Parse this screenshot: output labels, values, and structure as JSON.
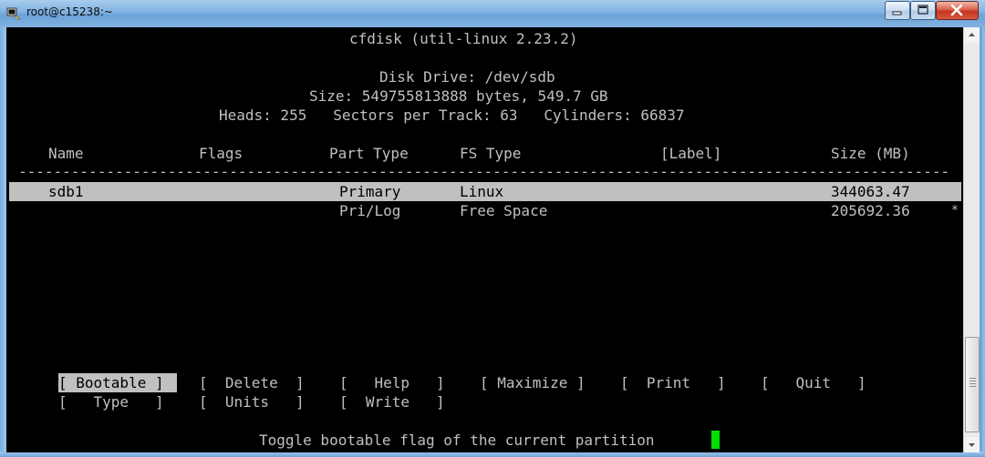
{
  "window": {
    "title": "root@c15238:~",
    "icons": {
      "app": "putty-icon",
      "minimize": "minimize-icon",
      "maximize": "maximize-icon",
      "close": "close-icon"
    }
  },
  "header": {
    "program": "cfdisk (util-linux 2.23.2)",
    "disk_drive": "Disk Drive: /dev/sdb",
    "size": "Size: 549755813888 bytes, 549.7 GB",
    "geometry": "Heads: 255   Sectors per Track: 63   Cylinders: 66837"
  },
  "table": {
    "columns": [
      "Name",
      "Flags",
      "Part Type",
      "FS Type",
      "[Label]",
      "Size (MB)"
    ],
    "separator": "-------------------------------------------------------------------------------------------------------------------",
    "rows": [
      {
        "name": "sdb1",
        "flags": "",
        "part_type": "Primary",
        "fs_type": "Linux",
        "label": "",
        "size": "344063.47",
        "selected": true
      },
      {
        "name": "",
        "flags": "",
        "part_type": "Pri/Log",
        "fs_type": "Free Space",
        "label": "",
        "size": "205692.36",
        "marker": "*",
        "selected": false
      }
    ]
  },
  "menu": {
    "items": [
      "[ Bootable ]",
      "[  Delete  ]",
      "[   Help   ]",
      "[ Maximize ]",
      "[  Print   ]",
      "[   Quit   ]",
      "[   Type   ]",
      "[  Units   ]",
      "[  Write   ]"
    ],
    "selected": "[ Bootable ]"
  },
  "status": {
    "help_text": "Toggle bootable flag of the current partition"
  },
  "colors": {
    "terminal_bg": "#000000",
    "terminal_fg": "#c0c0c0",
    "highlight_bg": "#c0c0c0",
    "cursor": "#00e000"
  }
}
